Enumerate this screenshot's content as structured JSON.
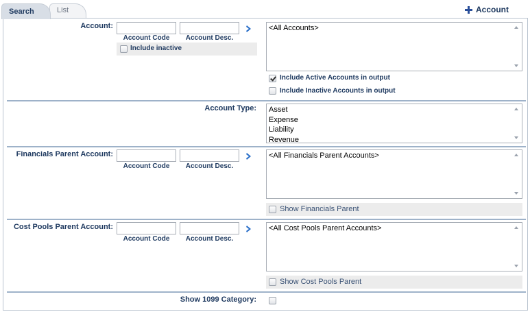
{
  "tabs": [
    {
      "label": "Search"
    },
    {
      "label": "List"
    }
  ],
  "header": {
    "add_account_label": "Account"
  },
  "account": {
    "label": "Account:",
    "code_caption": "Account Code",
    "desc_caption": "Account Desc.",
    "include_inactive_label": "Include inactive",
    "list_items": [
      "<All Accounts>"
    ],
    "include_active_output_label": "Include Active Accounts in output",
    "include_active_output_checked": true,
    "include_inactive_output_label": "Include Inactive Accounts in output",
    "include_inactive_output_checked": false
  },
  "account_type": {
    "label": "Account Type:",
    "options": [
      "Asset",
      "Expense",
      "Liability",
      "Revenue"
    ]
  },
  "financials_parent": {
    "label": "Financials Parent Account:",
    "code_caption": "Account Code",
    "desc_caption": "Account Desc.",
    "list_items": [
      "<All Financials Parent Accounts>"
    ],
    "show_label": "Show Financials Parent"
  },
  "cost_pools_parent": {
    "label": "Cost Pools Parent Account:",
    "code_caption": "Account Code",
    "desc_caption": "Account Desc.",
    "list_items": [
      "<All Cost Pools Parent Accounts>"
    ],
    "show_label": "Show Cost Pools Parent"
  },
  "show_1099": {
    "label": "Show 1099 Category:"
  }
}
